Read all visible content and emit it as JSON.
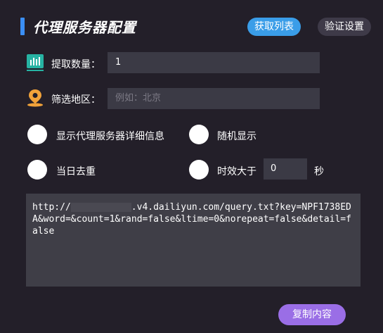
{
  "header": {
    "title": "代理服务器配置",
    "fetch_button": "获取列表",
    "verify_button": "验证设置"
  },
  "form": {
    "quantity": {
      "label": "提取数量：",
      "value": "1",
      "icon": "bar-chart-icon"
    },
    "region": {
      "label": "筛选地区：",
      "placeholder": "例如：北京",
      "icon": "location-pin-icon"
    }
  },
  "options": {
    "show_details": "显示代理服务器详细信息",
    "random_display": "随机显示",
    "same_day_dedup": "当日去重",
    "expires_after": "时效大于",
    "expires_value": "0",
    "seconds_unit": "秒"
  },
  "url": {
    "prefix": "http://",
    "suffix": ".v4.dailiyun.com/query.txt?key=NPF1738EDA&word=&count=1&rand=false&ltime=0&norepeat=false&detail=false"
  },
  "actions": {
    "copy_button": "复制内容"
  },
  "colors": {
    "background": "#231f29",
    "accent_blue": "#3a9de8",
    "copy_purple": "#9a6ee6",
    "icon_teal": "#27b3a3",
    "icon_orange": "#f2a33a"
  }
}
